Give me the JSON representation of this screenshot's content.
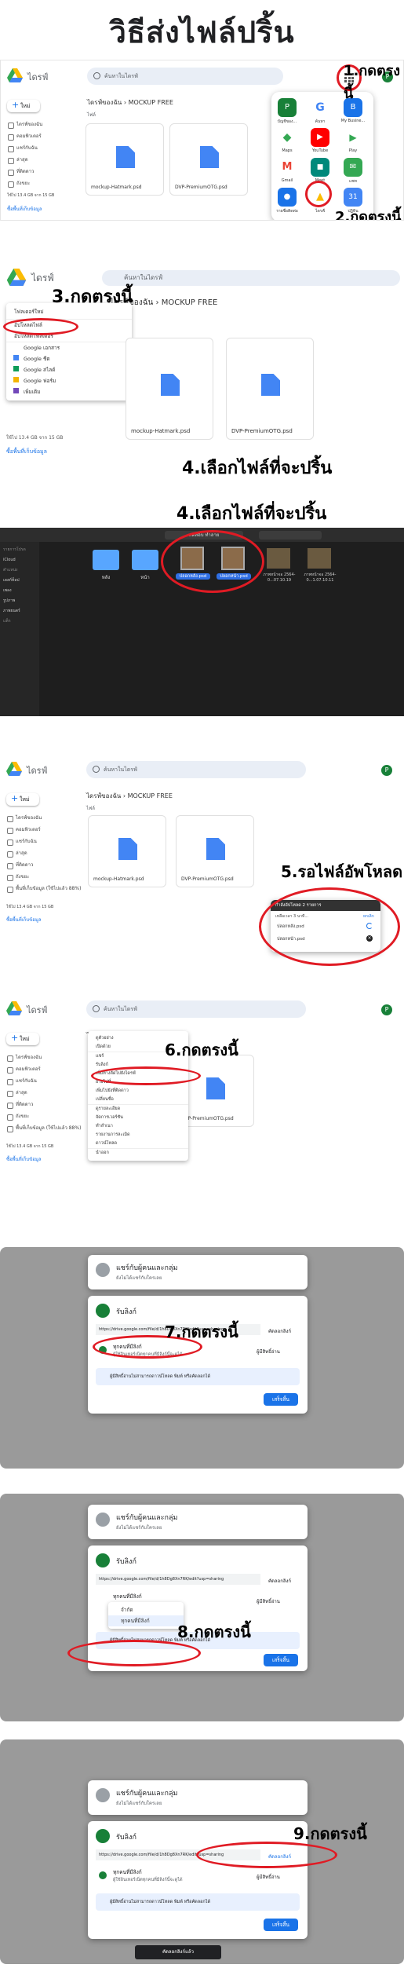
{
  "page_title": "วิธีส่งไฟล์ปริ้น",
  "drive": {
    "brand": "ไดรฟ์",
    "search_placeholder": "ค้นหาในไดรฟ์",
    "new_label": "ใหม่",
    "sidebar": [
      "ไดรฟ์ของฉัน",
      "คอมพิวเตอร์",
      "แชร์กับฉัน",
      "ล่าสุด",
      "ที่ติดดาว",
      "ถังขยะ",
      "พื้นที่เก็บข้อมูล (ใช้ไปแล้ว 88%)"
    ],
    "storage_text": "ใช้ไป 13.4 GB จาก 15 GB",
    "buy_storage": "ซื้อพื้นที่เก็บข้อมูล",
    "breadcrumb_root": "ไดรฟ์ของฉัน",
    "breadcrumb_folder": "MOCKUP FREE",
    "section_label": "ไฟล์",
    "files": [
      "mockup-Hatmark.psd",
      "DVP-PremiumOTG.psd"
    ]
  },
  "steps": {
    "s1": "1.กดตรงนี้",
    "s2": "2.กดตรงนี้",
    "s3": "3.กดตรงนี้",
    "s4a": "4.เลือกไฟล์ที่จะปริ้น",
    "s4b": "4.เลือกไฟล์ที่จะปริ้น",
    "s5": "5.รอไฟล์อัพโหลด",
    "s6": "6.กดตรงนี้",
    "s7": "7.กดตรงนี้",
    "s8": "8.กดตรงนี้",
    "s9": "9.กดตรงนี้"
  },
  "apps": [
    {
      "label": "บัญชีของ...",
      "color": "#188038",
      "letter": "P"
    },
    {
      "label": "ค้นหา",
      "color": "#ffffff",
      "letter": "G"
    },
    {
      "label": "My Busine...",
      "color": "#1a73e8",
      "letter": "B"
    },
    {
      "label": "Maps",
      "color": "#ffffff",
      "letter": "◆"
    },
    {
      "label": "YouTube",
      "color": "#ff0000",
      "letter": "▶"
    },
    {
      "label": "Play",
      "color": "#ffffff",
      "letter": "▶"
    },
    {
      "label": "Gmail",
      "color": "#ffffff",
      "letter": "M"
    },
    {
      "label": "Meet",
      "color": "#00897b",
      "letter": "■"
    },
    {
      "label": "แชท",
      "color": "#34a853",
      "letter": "✉"
    },
    {
      "label": "รายชื่อติดต่อ",
      "color": "#1a73e8",
      "letter": "●"
    },
    {
      "label": "ไดรฟ์",
      "color": "#ffffff",
      "letter": "▲"
    },
    {
      "label": "ปฏิทิน",
      "color": "#4285f4",
      "letter": "31"
    }
  ],
  "new_menu": {
    "items": [
      "โฟลเดอร์ใหม่",
      "อัปโหลดไฟล์",
      "อัปโหลดโฟลเดอร์",
      "Google เอกสาร",
      "Google ชีต",
      "Google สไลด์",
      "Google ฟอร์ม",
      "เพิ่มเติม"
    ]
  },
  "picker": {
    "sidebar": [
      "รายการโปรด",
      "iCloud",
      "ตำแหน่ง",
      "เดสก์ท็อป",
      "เพลง",
      "รูปภาพ",
      "ภาพยนตร์",
      "แท็ก"
    ],
    "location": "ทดสอบ ทำลาย",
    "folders": [
      "หลัง",
      "หน้า"
    ],
    "selected": [
      "ปลอกหลัง.psd",
      "ปลอกหน้า.psd"
    ],
    "others": [
      "ภาพหน้าจอ 2564-0...07.10.19",
      "ภาพหน้าจอ 2564-0...1.07.10.11"
    ]
  },
  "upload": {
    "header": "กำลังอัปโหลด 2 รายการ",
    "sub": "เหลือเวลา 3 นาที...",
    "cancel": "ยกเลิก",
    "files": [
      "ปลอกหลัง.psd",
      "ปลอกหน้า.psd"
    ]
  },
  "context_menu": [
    "ดูตัวอย่าง",
    "เปิดด้วย",
    "แชร์",
    "รับลิงก์",
    "เพิ่มทางลัดไปยังไดรฟ์",
    "ย้ายไปที่",
    "เพิ่มไปยังที่ติดดาว",
    "เปลี่ยนชื่อ",
    "ดูรายละเอียด",
    "จัดการเวอร์ชัน",
    "ทำสำเนา",
    "รายงานการละเมิด",
    "ดาวน์โหลด",
    "นำออก"
  ],
  "share": {
    "title": "แชร์กับผู้คนและกลุ่ม",
    "subtitle": "ยังไม่ได้แชร์กับใครเลย",
    "get_link_title": "รับลิงก์",
    "url": "https://drive.google.com/file/d/1h8Dg8Xn7RK/edit?usp=sharing",
    "copy_link": "คัดลอกลิงก์",
    "access_label": "ทุกคนที่มีลิงก์",
    "access_desc": "ผู้ใช้อินเทอร์เน็ตทุกคนที่มีลิงก์นี้จะดูได้",
    "role": "ผู้มีสิทธิ์อ่าน",
    "info": "ผู้มีสิทธิ์อ่านไม่สามารถดาวน์โหลด พิมพ์ หรือคัดลอกได้",
    "done": "เสร็จสิ้น",
    "restricted": "จำกัด",
    "copied_toast": "คัดลอกลิงก์แล้ว"
  }
}
